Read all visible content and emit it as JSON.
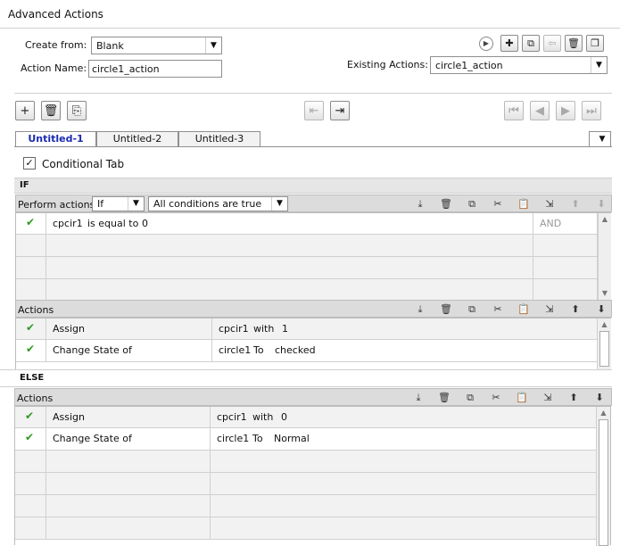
{
  "window": {
    "title": "Advanced Actions"
  },
  "header": {
    "create_from_label": "Create from:",
    "create_from_value": "Blank",
    "action_name_label": "Action Name:",
    "action_name_value": "circle1_action",
    "existing_actions_label": "Existing Actions:",
    "existing_actions_value": "circle1_action"
  },
  "tabs": [
    {
      "label": "Untitled-1",
      "active": true
    },
    {
      "label": "Untitled-2",
      "active": false
    },
    {
      "label": "Untitled-3",
      "active": false
    }
  ],
  "conditional_tab": {
    "label": "Conditional Tab",
    "checked": true
  },
  "if_section": {
    "title": "IF",
    "perform_actions_label": "Perform actions:",
    "perform_mode": "If",
    "condition_mode": "All conditions are true",
    "conditions": [
      {
        "variable": "cpcir1",
        "operator": "is equal to",
        "value": "0",
        "logic": "AND"
      }
    ],
    "actions_label": "Actions",
    "actions": [
      {
        "action": "Assign",
        "target": "cpcir1",
        "op": "with",
        "value": "1"
      },
      {
        "action": "Change State of",
        "target": "circle1",
        "op": "To",
        "value": "checked"
      }
    ]
  },
  "else_section": {
    "title": "ELSE",
    "actions_label": "Actions",
    "actions": [
      {
        "action": "Assign",
        "target": "cpcir1",
        "op": "with",
        "value": "0"
      },
      {
        "action": "Change State of",
        "target": "circle1",
        "op": "To",
        "value": "Normal"
      }
    ]
  },
  "colors": {
    "active_tab": "#1a2ab3",
    "check": "#2d9a1e",
    "toolbar": "#dcdcdc"
  }
}
